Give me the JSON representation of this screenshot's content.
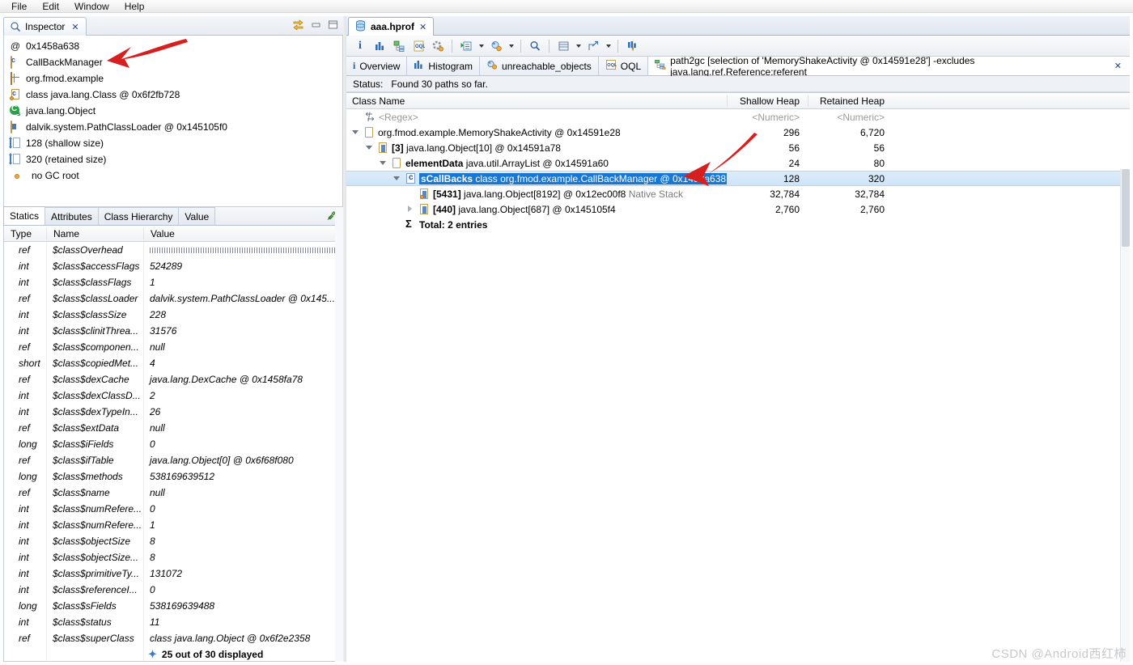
{
  "menubar": {
    "items": [
      {
        "label": "File"
      },
      {
        "label": "Edit"
      },
      {
        "label": "Window"
      },
      {
        "label": "Help"
      }
    ]
  },
  "inspector": {
    "tab_label": "Inspector",
    "tab_close": "✕",
    "icons": {
      "link": "link-with-editor-icon",
      "minimize": "minimize-icon",
      "maximize": "maximize-icon"
    },
    "rows": [
      {
        "icon": "at-icon",
        "label": "0x1458a638"
      },
      {
        "icon": "class-file-icon",
        "label": "CallBackManager"
      },
      {
        "icon": "package-icon",
        "label": "org.fmod.example"
      },
      {
        "icon": "class-object-icon",
        "label": "class java.lang.Class @ 0x6f2fb728"
      },
      {
        "icon": "superclass-icon",
        "label": "java.lang.Object"
      },
      {
        "icon": "classloader-icon",
        "label": "dalvik.system.PathClassLoader @ 0x145105f0"
      },
      {
        "icon": "shallow-size-icon",
        "label": "128 (shallow size)"
      },
      {
        "icon": "retained-size-icon",
        "label": "320 (retained size)"
      },
      {
        "icon": "gc-root-icon",
        "label": "no GC root"
      }
    ]
  },
  "statics_panel": {
    "tabs": [
      {
        "label": "Statics",
        "active": true
      },
      {
        "label": "Attributes",
        "active": false
      },
      {
        "label": "Class Hierarchy",
        "active": false
      },
      {
        "label": "Value",
        "active": false
      }
    ],
    "pin_icon": "pin-icon",
    "columns": [
      "Type",
      "Name",
      "Value"
    ],
    "rows": [
      {
        "type": "ref",
        "name": "$classOverhead",
        "value": "",
        "value_is_bar": true
      },
      {
        "type": "int",
        "name": "$class$accessFlags",
        "value": "524289"
      },
      {
        "type": "int",
        "name": "$class$classFlags",
        "value": "1"
      },
      {
        "type": "ref",
        "name": "$class$classLoader",
        "value": "dalvik.system.PathClassLoader @ 0x145..."
      },
      {
        "type": "int",
        "name": "$class$classSize",
        "value": "228"
      },
      {
        "type": "int",
        "name": "$class$clinitThrea...",
        "value": "31576"
      },
      {
        "type": "ref",
        "name": "$class$componen...",
        "value": "null"
      },
      {
        "type": "short",
        "name": "$class$copiedMet...",
        "value": "4"
      },
      {
        "type": "ref",
        "name": "$class$dexCache",
        "value": "java.lang.DexCache @ 0x1458fa78"
      },
      {
        "type": "int",
        "name": "$class$dexClassD...",
        "value": "2"
      },
      {
        "type": "int",
        "name": "$class$dexTypeIn...",
        "value": "26"
      },
      {
        "type": "ref",
        "name": "$class$extData",
        "value": "null"
      },
      {
        "type": "long",
        "name": "$class$iFields",
        "value": "0"
      },
      {
        "type": "ref",
        "name": "$class$ifTable",
        "value": "java.lang.Object[0] @ 0x6f68f080"
      },
      {
        "type": "long",
        "name": "$class$methods",
        "value": "538169639512"
      },
      {
        "type": "ref",
        "name": "$class$name",
        "value": "null"
      },
      {
        "type": "int",
        "name": "$class$numRefere...",
        "value": "0"
      },
      {
        "type": "int",
        "name": "$class$numRefere...",
        "value": "1"
      },
      {
        "type": "int",
        "name": "$class$objectSize",
        "value": "8"
      },
      {
        "type": "int",
        "name": "$class$objectSize...",
        "value": "8"
      },
      {
        "type": "int",
        "name": "$class$primitiveTy...",
        "value": "131072"
      },
      {
        "type": "int",
        "name": "$class$referenceI...",
        "value": "0"
      },
      {
        "type": "long",
        "name": "$class$sFields",
        "value": "538169639488"
      },
      {
        "type": "int",
        "name": "$class$status",
        "value": "11"
      },
      {
        "type": "ref",
        "name": "$class$superClass",
        "value": "class java.lang.Object @ 0x6f2e2358"
      }
    ],
    "footer": "25 out of 30 displayed"
  },
  "editor": {
    "tab_label": "aaa.hprof",
    "tab_close": "✕",
    "tab_icon": "heap-dump-icon",
    "toolbar": [
      {
        "icon": "overview-info-icon",
        "caret": false
      },
      {
        "icon": "histogram-icon",
        "caret": false
      },
      {
        "icon": "dominator-tree-icon",
        "caret": false
      },
      {
        "icon": "oql-icon",
        "caret": false
      },
      {
        "icon": "calculate-retained-icon",
        "caret": false
      },
      {
        "sep": true
      },
      {
        "icon": "run-query-icon",
        "caret": true
      },
      {
        "icon": "leak-suspects-icon",
        "caret": true
      },
      {
        "sep": true
      },
      {
        "icon": "search-icon",
        "caret": false
      },
      {
        "sep": true
      },
      {
        "icon": "group-by-icon",
        "caret": true
      },
      {
        "icon": "export-icon",
        "caret": true
      },
      {
        "sep": true
      },
      {
        "icon": "compare-icon",
        "caret": false
      }
    ],
    "inner_tabs": [
      {
        "icon": "info-icon",
        "label": "Overview",
        "active": false,
        "closable": false
      },
      {
        "icon": "histogram-icon",
        "label": "Histogram",
        "active": false,
        "closable": false
      },
      {
        "icon": "unreachable-icon",
        "label": "unreachable_objects",
        "active": false,
        "closable": false
      },
      {
        "icon": "oql-icon",
        "label": "OQL",
        "active": false,
        "closable": false
      },
      {
        "icon": "path2gc-icon",
        "label": "path2gc [selection of 'MemoryShakeActivity @ 0x14591e28'] -excludes java.lang.ref.Reference:referent",
        "active": true,
        "closable": true,
        "close": "✕"
      }
    ],
    "status": {
      "label": "Status:",
      "text": "Found 30 paths so far."
    },
    "table": {
      "columns": [
        "Class Name",
        "Shallow Heap",
        "Retained Heap"
      ],
      "filter_row": {
        "icon": "regex-filter-icon",
        "name": "<Regex>",
        "shallow": "<Numeric>",
        "retained": "<Numeric>"
      },
      "rows": [
        {
          "indent": 0,
          "twisty": "open",
          "icon": "object-icon",
          "bold": "",
          "text": "org.fmod.example.MemoryShakeActivity @ 0x14591e28",
          "suffix": "",
          "shallow": "296",
          "retained": "6,720",
          "selected": false
        },
        {
          "indent": 1,
          "twisty": "open",
          "icon": "array-icon",
          "bold": "[3] ",
          "text": "java.lang.Object[10] @ 0x14591a78",
          "suffix": "",
          "shallow": "56",
          "retained": "56",
          "selected": false
        },
        {
          "indent": 2,
          "twisty": "open",
          "icon": "object-icon",
          "bold": "elementData ",
          "text": "java.util.ArrayList @ 0x14591a60",
          "suffix": "",
          "shallow": "24",
          "retained": "80",
          "selected": false
        },
        {
          "indent": 3,
          "twisty": "open",
          "icon": "class-icon",
          "bold": "sCallBacks ",
          "text": "class org.fmod.example.CallBackManager @ 0x1458a638",
          "suffix": "",
          "shallow": "128",
          "retained": "320",
          "selected": true
        },
        {
          "indent": 4,
          "twisty": "none",
          "icon": "native-array-icon",
          "bold": "[5431] ",
          "text": "java.lang.Object[8192] @ 0x12ec00f8",
          "suffix": "Native Stack",
          "shallow": "32,784",
          "retained": "32,784",
          "selected": false
        },
        {
          "indent": 4,
          "twisty": "closed",
          "icon": "array-icon",
          "bold": "[440] ",
          "text": "java.lang.Object[687] @ 0x145105f4",
          "suffix": "",
          "shallow": "2,760",
          "retained": "2,760",
          "selected": false
        },
        {
          "indent": 3,
          "twisty": "none",
          "icon": "sum-icon",
          "bold": "Total: 2 entries",
          "text": "",
          "suffix": "",
          "shallow": "",
          "retained": "",
          "selected": false
        }
      ]
    }
  },
  "annotations": {
    "arrow_color": "#d62020",
    "arrow1_target": "CallBackManager",
    "arrow2_target": "sCallBacks row"
  },
  "watermark": "CSDN @Android西红柿"
}
